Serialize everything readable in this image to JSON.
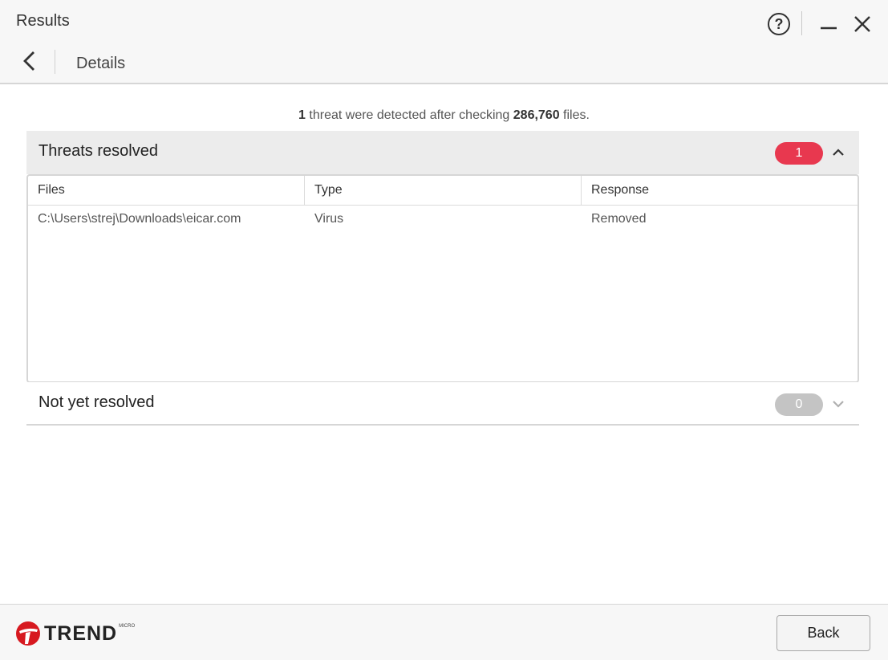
{
  "window": {
    "title": "Results",
    "subtitle": "Details"
  },
  "summary": {
    "count": "1",
    "text_middle": " threat were detected after checking ",
    "files_checked": "286,760",
    "text_end": " files."
  },
  "sections": {
    "resolved": {
      "label": "Threats resolved",
      "count": "1",
      "badge_color": "#e8384f",
      "expanded": true
    },
    "unresolved": {
      "label": "Not yet resolved",
      "count": "0",
      "badge_color": "#c4c4c4",
      "expanded": false
    }
  },
  "table": {
    "headers": [
      "Files",
      "Type",
      "Response"
    ],
    "rows": [
      [
        "C:\\Users\\strej\\Downloads\\eicar.com",
        "Virus",
        "Removed"
      ]
    ]
  },
  "footer": {
    "logo_text": "TREND",
    "logo_small": "MICRO",
    "back_label": "Back"
  },
  "icons": {
    "help": "help-icon",
    "minimize": "minimize-icon",
    "close": "close-icon",
    "back": "chevron-left-icon",
    "expand": "chevron-up-icon",
    "collapse": "chevron-down-icon",
    "logo": "trend-micro-logo-icon"
  }
}
